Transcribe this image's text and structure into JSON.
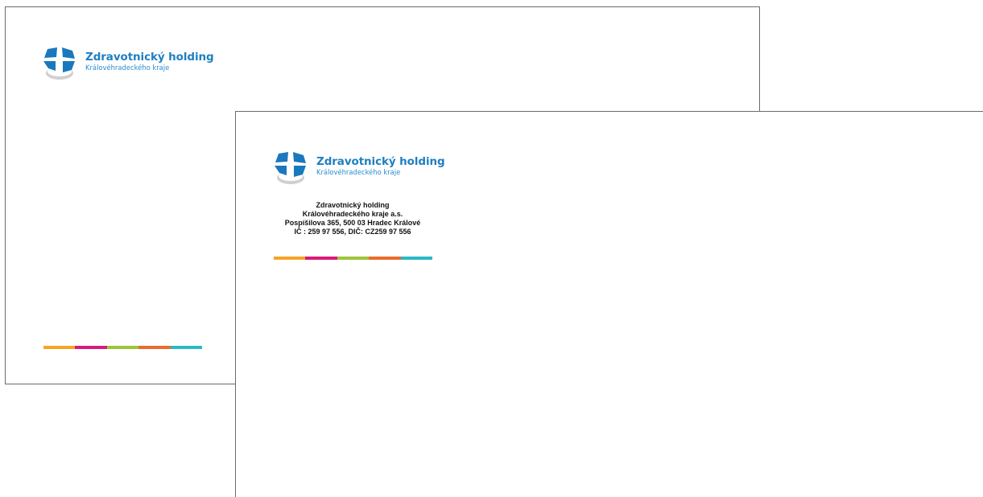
{
  "logo": {
    "name": "Zdravotnický holding",
    "subtitle": "Královéhradeckého kraje",
    "colors": {
      "blue": "#1a78be",
      "shadow": "#c8c8c8"
    }
  },
  "letterhead_back": {
    "logo_name": "Zdravotnický holding",
    "logo_subtitle": "Královéhradeckého kraje"
  },
  "envelope_front": {
    "logo_name": "Zdravotnický holding",
    "logo_subtitle": "Královéhradeckého kraje",
    "address": {
      "line1": "Zdravotnický holding",
      "line2": "Královéhradeckého kraje a.s.",
      "line3": "Pospíšilova 365, 500 03 Hradec Králové",
      "line4": "IČ : 259 97 556, DIČ: CZ259 97 556"
    }
  },
  "color_bar": [
    "#f4a526",
    "#d81b7a",
    "#9dc53b",
    "#ea6b2d",
    "#2bb8c6"
  ]
}
